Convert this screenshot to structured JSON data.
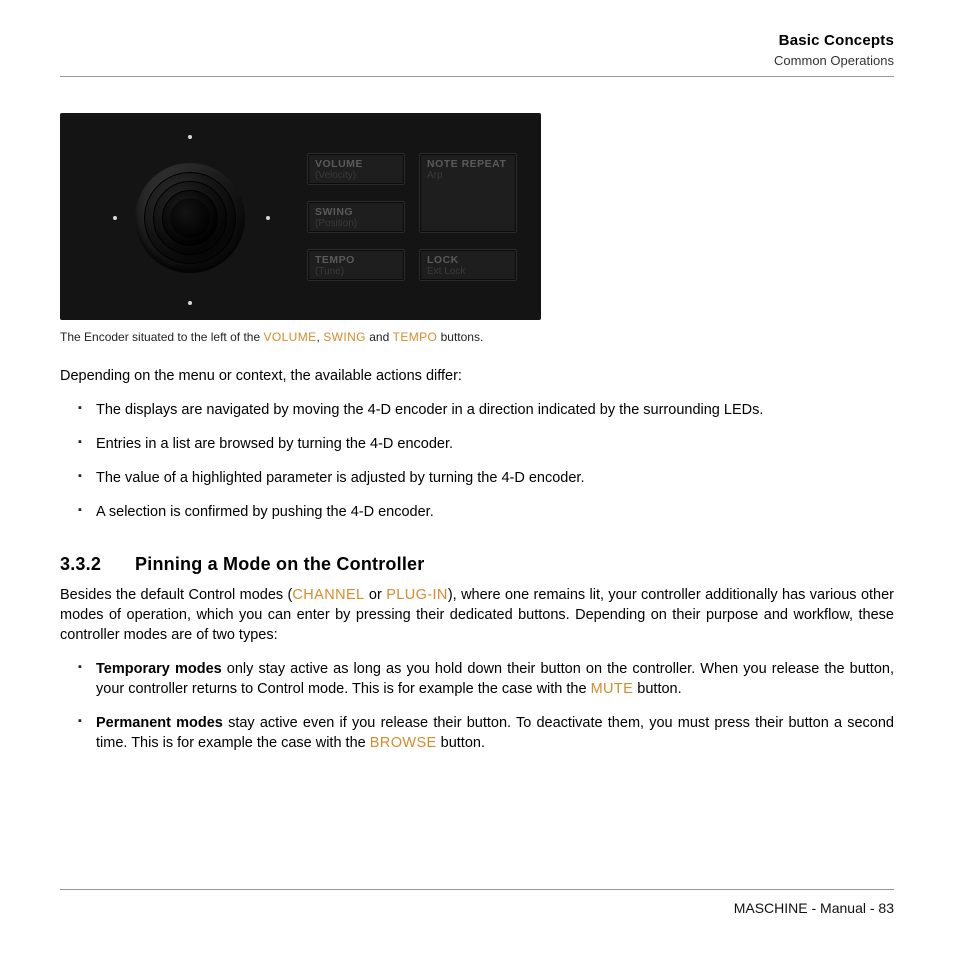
{
  "header": {
    "title": "Basic Concepts",
    "subtitle": "Common Operations"
  },
  "figure": {
    "buttons": {
      "volume": {
        "label": "VOLUME",
        "sub": "(Velocity)"
      },
      "swing": {
        "label": "SWING",
        "sub": "(Position)"
      },
      "tempo": {
        "label": "TEMPO",
        "sub": "(Tune)"
      },
      "note": {
        "label": "NOTE REPEAT",
        "sub": "Arp"
      },
      "lock": {
        "label": "LOCK",
        "sub": "Ext Lock"
      }
    },
    "caption": {
      "pre": "The Encoder situated to the left of the ",
      "v": "VOLUME",
      "sep1": ", ",
      "s": "SWING",
      "sep2": " and ",
      "t": "TEMPO",
      "post": " buttons."
    }
  },
  "intro": "Depending on the menu or context, the available actions differ:",
  "bullets1": [
    "The displays are navigated by moving the 4-D encoder in a direction indicated by the surrounding LEDs.",
    "Entries in a list are browsed by turning the 4-D encoder.",
    "The value of a highlighted parameter is adjusted by turning the 4-D encoder.",
    "A selection is confirmed by pushing the 4-D encoder."
  ],
  "section": {
    "num": "3.3.2",
    "title": "Pinning a Mode on the Controller"
  },
  "para2": {
    "a": "Besides the default Control modes (",
    "channel": "CHANNEL",
    "b": " or ",
    "plugin": "PLUG-IN",
    "c": "), where one remains lit, your controller additionally has various other modes of operation, which you can enter by pressing their dedicated buttons. Depending on their purpose and workflow, these controller modes are of two types:"
  },
  "bullets2": [
    {
      "lead": "Temporary modes",
      "a": " only stay active as long as you hold down their button on the controller. When you release the button, your controller returns to Control mode. This is for example the case with the ",
      "hw": "MUTE",
      "b": " button."
    },
    {
      "lead": "Permanent modes",
      "a": " stay active even if you release their button. To deactivate them, you must press their button a second time. This is for example the case with the ",
      "hw": "BROWSE",
      "b": " button."
    }
  ],
  "footer": {
    "product": "MASCHINE",
    "doc": "Manual",
    "page": "83"
  }
}
